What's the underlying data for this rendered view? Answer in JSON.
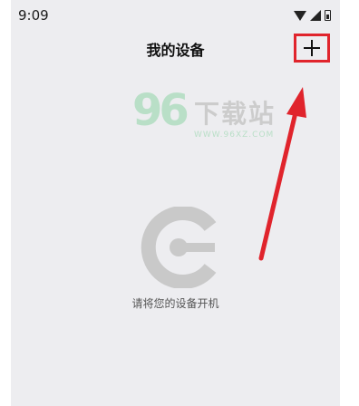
{
  "status_bar": {
    "time": "9:09",
    "icons": [
      "wifi-icon",
      "signal-icon",
      "battery-icon"
    ]
  },
  "header": {
    "title": "我的设备",
    "add_button_icon": "plus-icon"
  },
  "watermark": {
    "digits": "96",
    "title": "下载站",
    "url": "WWW.96XZ.COM"
  },
  "empty_state": {
    "icon": "device-power-logo-icon",
    "message": "请将您的设备开机"
  },
  "colors": {
    "background": "#ededf0",
    "highlight": "#e0242c",
    "logo_gray": "#c9c9c9",
    "watermark_green": "#b9dfc7"
  }
}
